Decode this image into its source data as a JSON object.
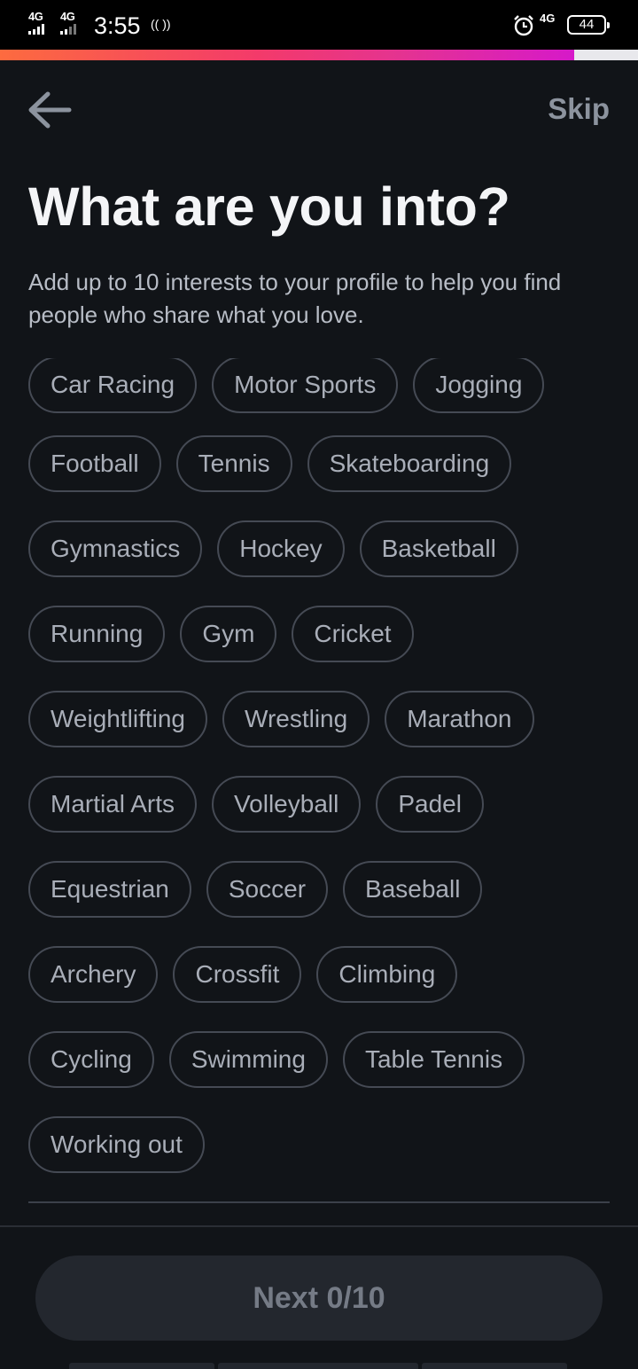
{
  "status_bar": {
    "network_left_1": "4G",
    "network_left_2": "4G",
    "time": "3:55",
    "hotspot": "(( ))",
    "network_right": "4G",
    "battery": "44"
  },
  "progress": {
    "value_percent": 90,
    "accent_start": "#fd6b3f",
    "accent_end": "#d619c9"
  },
  "header": {
    "back_icon": "arrow-left-icon",
    "skip_label": "Skip"
  },
  "title": "What are you into?",
  "subtitle": "Add up to 10 interests to your profile to help you find people who share what you love.",
  "interests": {
    "rows": [
      [
        "Car Racing",
        "Motor Sports",
        "Jogging"
      ],
      [
        "Football",
        "Tennis",
        "Skateboarding"
      ],
      [
        "Gymnastics",
        "Hockey",
        "Basketball"
      ],
      [
        "Running",
        "Gym",
        "Cricket"
      ],
      [
        "Weightlifting",
        "Wrestling",
        "Marathon"
      ],
      [
        "Martial Arts",
        "Volleyball",
        "Padel"
      ],
      [
        "Equestrian",
        "Soccer",
        "Baseball"
      ],
      [
        "Archery",
        "Crossfit",
        "Climbing"
      ],
      [
        "Cycling",
        "Swimming",
        "Table Tennis"
      ],
      [
        "Working out"
      ]
    ],
    "selected_count": 0
  },
  "footer": {
    "next_label": "Next 0/10"
  }
}
